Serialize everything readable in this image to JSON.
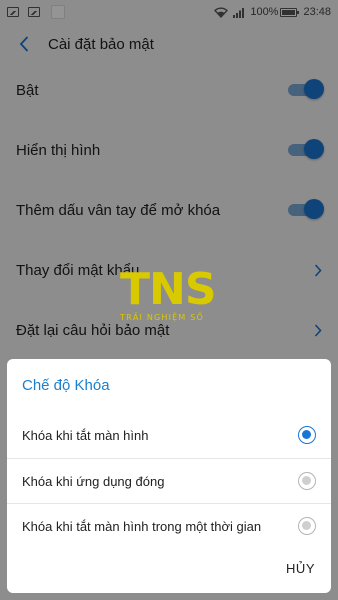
{
  "status_bar": {
    "battery_percent": "100%",
    "time": "23:48",
    "icons": [
      "image-icon",
      "image-icon",
      "notification-square-icon",
      "wifi-icon",
      "signal-icon",
      "battery-icon"
    ]
  },
  "header": {
    "title": "Cài đặt bảo mật",
    "back_icon": "chevron-left-icon"
  },
  "settings": {
    "rows": [
      {
        "label": "Bật",
        "control": "toggle",
        "on": true
      },
      {
        "label": "Hiển thị hình",
        "control": "toggle",
        "on": true
      },
      {
        "label": "Thêm dấu vân tay để mở khóa",
        "control": "toggle",
        "on": true
      },
      {
        "label": "Thay đổi mật khẩu",
        "control": "chevron"
      },
      {
        "label": "Đặt lại câu hỏi bảo mật",
        "control": "chevron"
      }
    ]
  },
  "watermark": {
    "logo": "TNS",
    "tagline": "TRẢI NGHIỆM SỐ"
  },
  "dialog": {
    "title": "Chế độ Khóa",
    "options": [
      {
        "label": "Khóa khi tắt màn hình",
        "selected": true
      },
      {
        "label": "Khóa khi ứng dụng đóng",
        "selected": false
      },
      {
        "label": "Khóa khi tắt màn hình trong một thời gian",
        "selected": false
      }
    ],
    "cancel_label": "HỦY"
  },
  "colors": {
    "accent": "#1976d2",
    "dialog_title": "#1a7fcf",
    "watermark": "#d9c900"
  }
}
